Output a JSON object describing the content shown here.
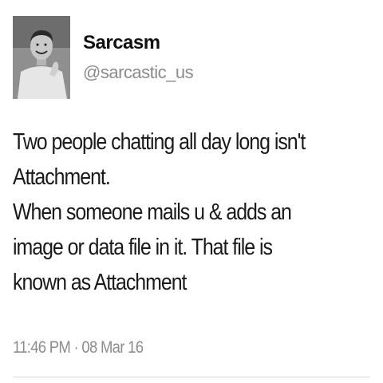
{
  "tweet": {
    "author": {
      "display_name": "Sarcasm",
      "handle": "@sarcastic_us",
      "avatar_icon": "profile-photo"
    },
    "body_lines": [
      "Two people chatting all day long isn't",
      "Attachment.",
      "When someone mails u & adds an",
      "image or data file in it. That file is",
      "known as Attachment"
    ],
    "timestamp": "11:46 PM · 08 Mar 16"
  }
}
